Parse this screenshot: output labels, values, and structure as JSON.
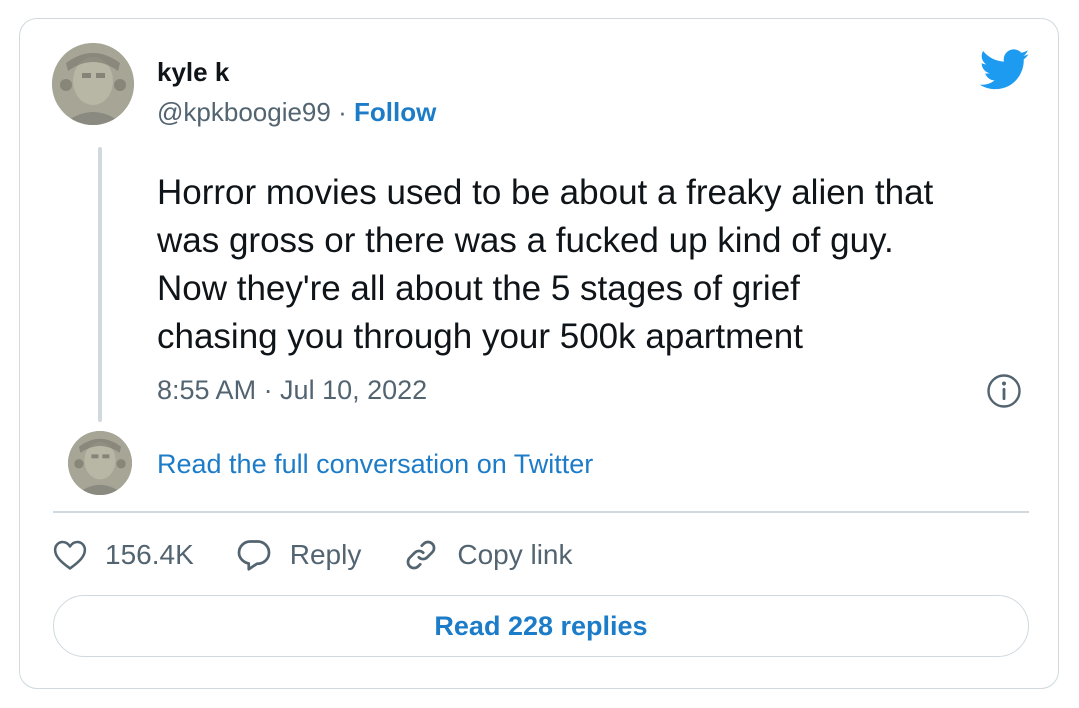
{
  "author": {
    "name": "kyle k",
    "handle": "@kpkboogie99",
    "separator": "·",
    "follow_label": "Follow"
  },
  "tweet": {
    "lines": [
      "Horror movies used to be about a freaky alien that",
      "was gross or there was a fucked up kind of guy.",
      "Now they're all about the 5 stages of grief",
      "chasing you through your 500k apartment"
    ],
    "timestamp": "8:55 AM · Jul 10, 2022"
  },
  "conversation_link": "Read the full conversation on Twitter",
  "actions": {
    "likes": "156.4K",
    "reply_label": "Reply",
    "copy_link_label": "Copy link"
  },
  "read_replies_label": "Read 228 replies",
  "icons": {
    "brand": "twitter-bird-icon",
    "info": "info-icon",
    "like": "heart-icon",
    "reply": "speech-bubble-icon",
    "copy": "link-icon"
  },
  "colors": {
    "accent": "#1d7cc8",
    "twitter_blue": "#1d9bf0",
    "secondary_text": "#536471",
    "primary_text": "#0f1419",
    "border": "#cfd9de"
  }
}
